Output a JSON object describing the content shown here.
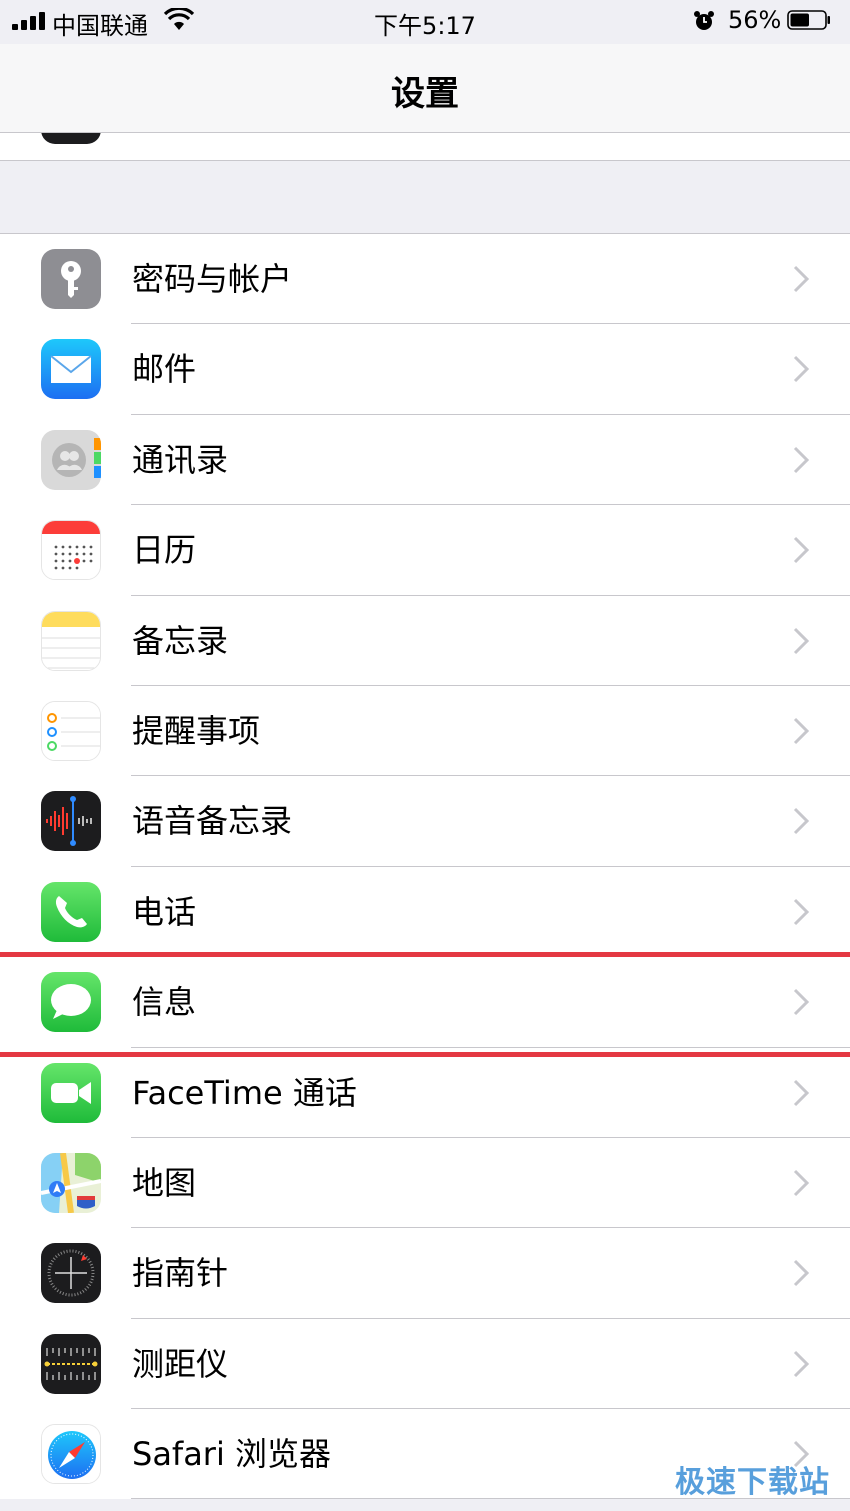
{
  "status_bar": {
    "carrier": "中国联通",
    "time": "下午5:17",
    "battery_percent": "56%",
    "battery_level": 0.56
  },
  "nav": {
    "title": "设置"
  },
  "settings_items": [
    {
      "label": "密码与帐户",
      "icon": "key-icon"
    },
    {
      "label": "邮件",
      "icon": "mail-icon"
    },
    {
      "label": "通讯录",
      "icon": "contacts-icon"
    },
    {
      "label": "日历",
      "icon": "calendar-icon"
    },
    {
      "label": "备忘录",
      "icon": "notes-icon"
    },
    {
      "label": "提醒事项",
      "icon": "reminders-icon"
    },
    {
      "label": "语音备忘录",
      "icon": "voice-memos-icon"
    },
    {
      "label": "电话",
      "icon": "phone-icon"
    },
    {
      "label": "信息",
      "icon": "messages-icon",
      "highlighted": true
    },
    {
      "label": "FaceTime 通话",
      "icon": "facetime-icon"
    },
    {
      "label": "地图",
      "icon": "maps-icon"
    },
    {
      "label": "指南针",
      "icon": "compass-icon"
    },
    {
      "label": "测距仪",
      "icon": "measure-icon"
    },
    {
      "label": "Safari 浏览器",
      "icon": "safari-icon"
    }
  ],
  "watermark": "极速下载站",
  "colors": {
    "highlight": "#e43842",
    "chevron": "#c7c7cc",
    "separator": "#c8c7cc"
  }
}
